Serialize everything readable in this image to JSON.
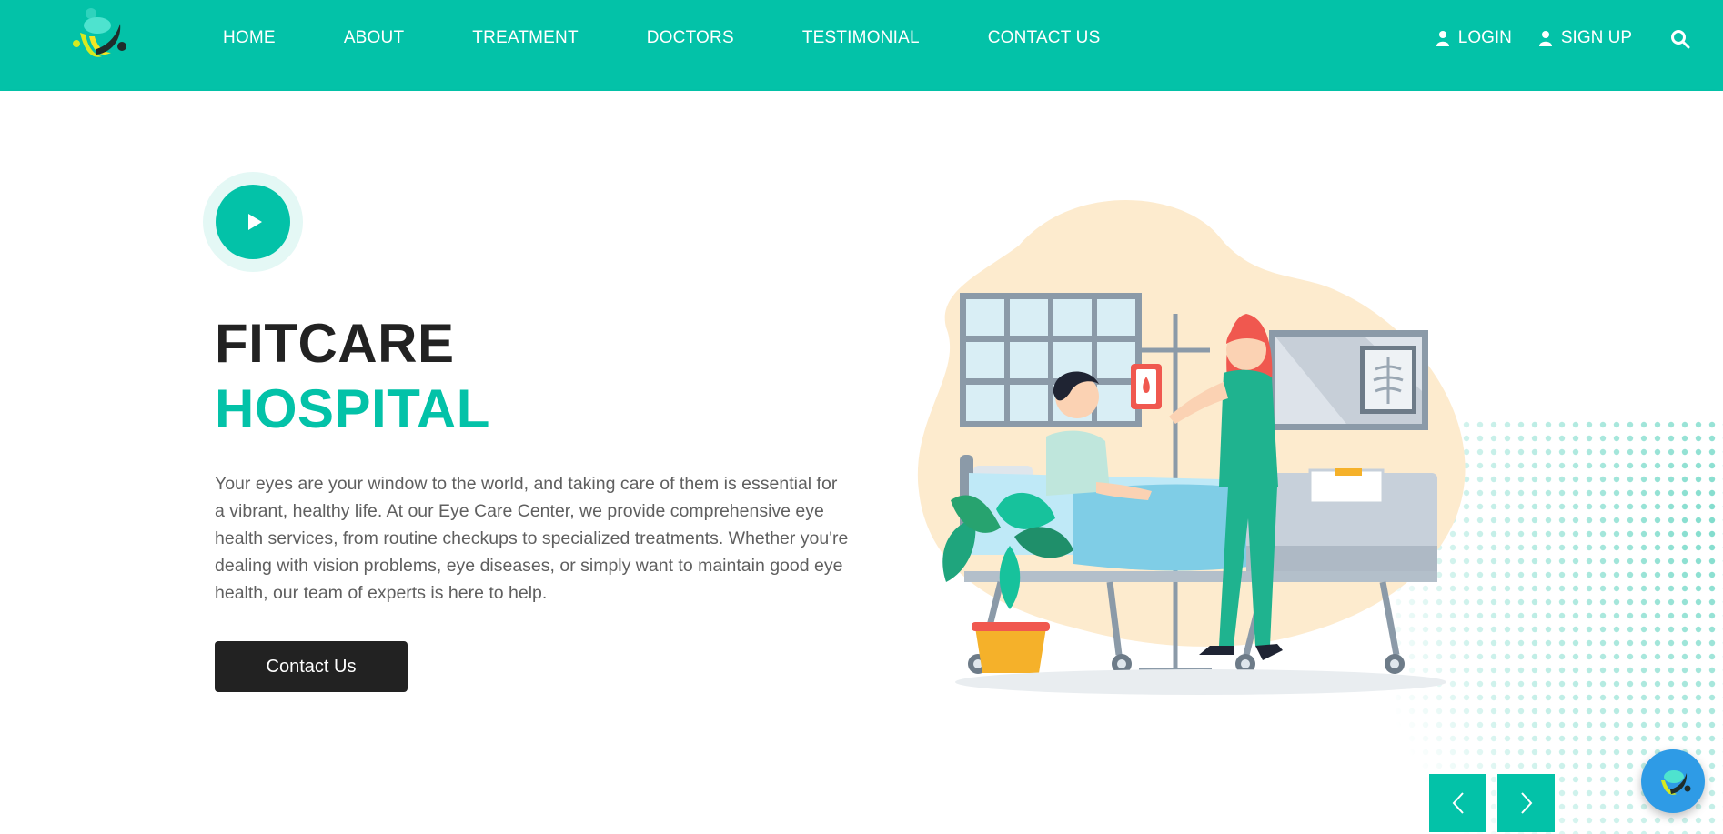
{
  "nav": {
    "items": [
      {
        "label": "HOME"
      },
      {
        "label": "ABOUT"
      },
      {
        "label": "TREATMENT"
      },
      {
        "label": "DOCTORS"
      },
      {
        "label": "TESTIMONIAL"
      },
      {
        "label": "CONTACT US"
      }
    ]
  },
  "auth": {
    "login_label": "LOGIN",
    "signup_label": "SIGN UP"
  },
  "hero": {
    "title_line1": "FITCARE",
    "title_line2": "HOSPITAL",
    "description": "Your eyes are your window to the world, and taking care of them is essential for a vibrant, healthy life. At our Eye Care Center, we provide comprehensive eye health services, from routine checkups to specialized treatments. Whether you're dealing with vision problems, eye diseases, or simply want to maintain good eye health, our team of experts is here to help.",
    "cta_label": "Contact Us"
  },
  "colors": {
    "brand": "#03c2a8",
    "dark": "#222222",
    "text": "#5f5f5f",
    "chat": "#2e9be6"
  },
  "icons": {
    "logo": "fitcare-logo",
    "user": "user-icon",
    "search": "search-icon",
    "play": "play-icon",
    "prev": "chevron-left-icon",
    "next": "chevron-right-icon",
    "chat": "chat-widget-icon"
  }
}
